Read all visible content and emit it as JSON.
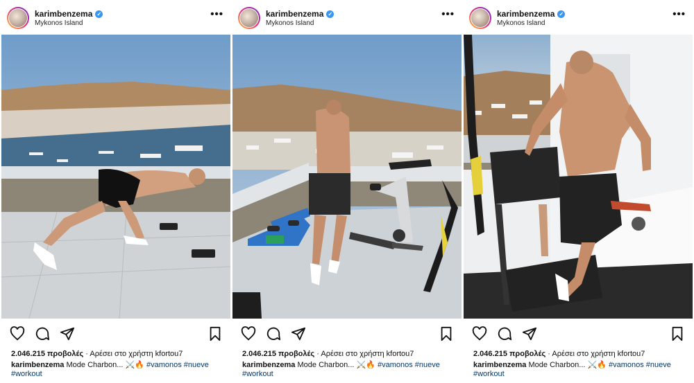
{
  "posts": [
    {
      "username": "karimbenzema",
      "location": "Mykonos Island",
      "views_count": "2.046.215 προβολές",
      "liked_by": "Αρέσει στο χρήστη kfortou7",
      "caption_text": "Mode Charbon... ⚔️🔥",
      "hashtags": [
        "#vamonos",
        "#nueve",
        "#workout"
      ],
      "scene": "terrace-pushup"
    },
    {
      "username": "karimbenzema",
      "location": "Mykonos Island",
      "views_count": "2.046.215 προβολές",
      "liked_by": "Αρέσει στο χρήστη kfortou7",
      "caption_text": "Mode Charbon... ⚔️🔥",
      "hashtags": [
        "#vamonos",
        "#nueve",
        "#workout"
      ],
      "scene": "terrace-bike"
    },
    {
      "username": "karimbenzema",
      "location": "Mykonos Island",
      "views_count": "2.046.215 προβολές",
      "liked_by": "Αρέσει στο χρήστη kfortou7",
      "caption_text": "Mode Charbon... ⚔️🔥",
      "hashtags": [
        "#vamonos",
        "#nueve",
        "#workout"
      ],
      "scene": "treadmill"
    }
  ],
  "icons": [
    "verified-badge-icon",
    "more-options-icon",
    "heart-icon",
    "comment-icon",
    "share-icon",
    "bookmark-icon"
  ],
  "colors": {
    "verified": "#3897f0",
    "hashtag": "#00376b"
  }
}
